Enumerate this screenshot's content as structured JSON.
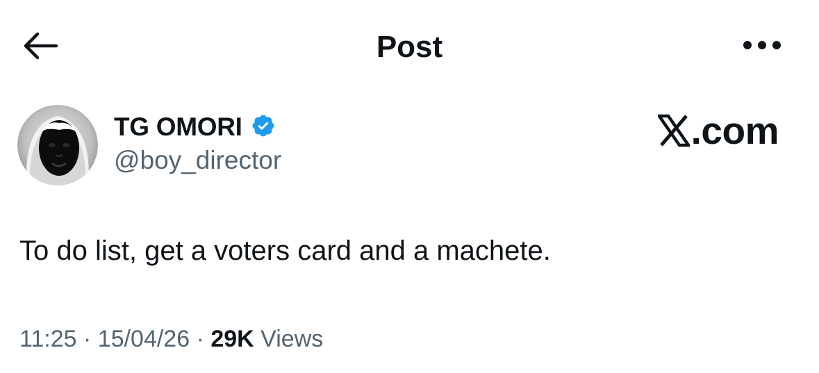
{
  "header": {
    "title": "Post",
    "back_icon": "arrow-left-icon",
    "more_icon": "more-horizontal-icon"
  },
  "author": {
    "name": "TG OMORI",
    "handle": "@boy_director",
    "verified": true,
    "verified_color": "#1d9bf0"
  },
  "watermark": {
    "text": ".com",
    "icon": "x-logo-icon"
  },
  "post": {
    "text": "To do list, get a voters card and a machete."
  },
  "meta": {
    "time": "11:25",
    "separator": " · ",
    "date": "15/04/26",
    "views_count": "29K",
    "views_label": " Views"
  },
  "colors": {
    "text_primary": "#0f1419",
    "text_secondary": "#536471",
    "accent": "#1d9bf0",
    "background": "#ffffff"
  }
}
